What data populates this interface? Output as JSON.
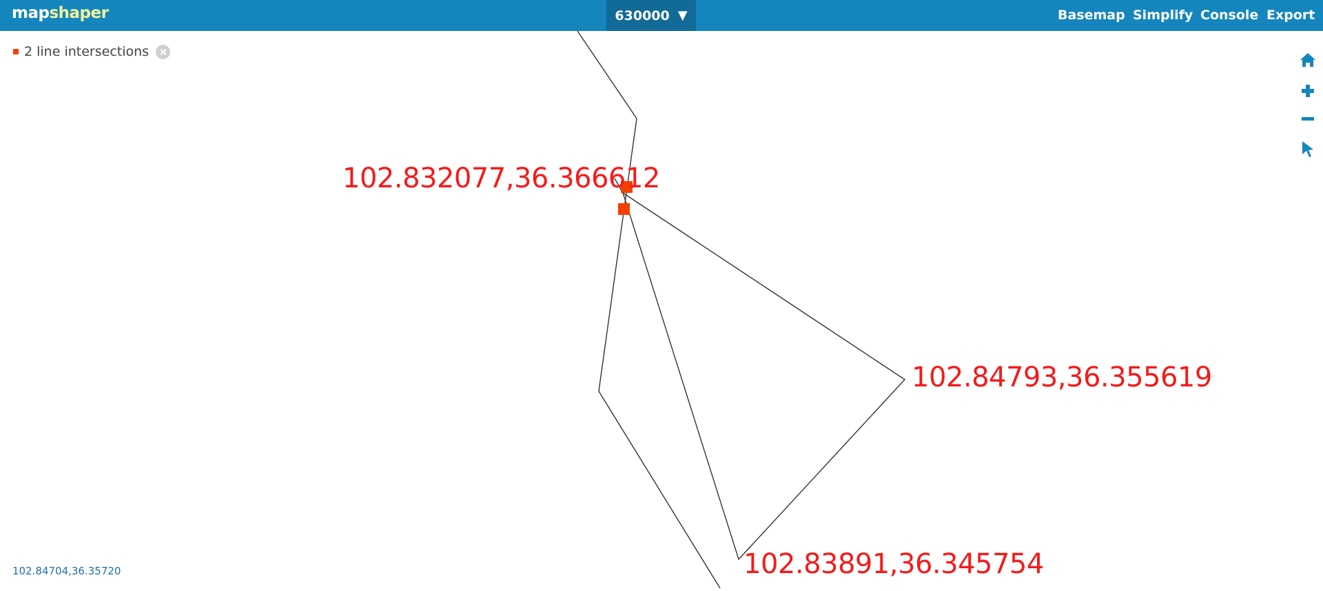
{
  "app": {
    "logo_part1": "map",
    "logo_part2": "shaper"
  },
  "header": {
    "layer_name": "630000",
    "layer_caret": "▼",
    "menu": [
      "Basemap",
      "Simplify",
      "Console",
      "Export"
    ]
  },
  "status": {
    "intersections_text": "2 line intersections"
  },
  "map": {
    "line_color": "#333333",
    "marker_color": "#f54000",
    "labels": {
      "point1": "102.832077,36.366612",
      "point2": "102.84793,36.355619",
      "point3": "102.83891,36.345754"
    }
  },
  "tools": [
    "home-icon",
    "zoom-in-icon",
    "zoom-out-icon",
    "select-pointer-icon"
  ],
  "footer": {
    "cursor_coords": "102.84704,36.35720"
  },
  "colors": {
    "topbar": "#1486bd",
    "layer_button": "#116b96",
    "logo_accent": "#f4f29a",
    "label_red": "#f51a1a",
    "icon_blue": "#1486bd"
  }
}
